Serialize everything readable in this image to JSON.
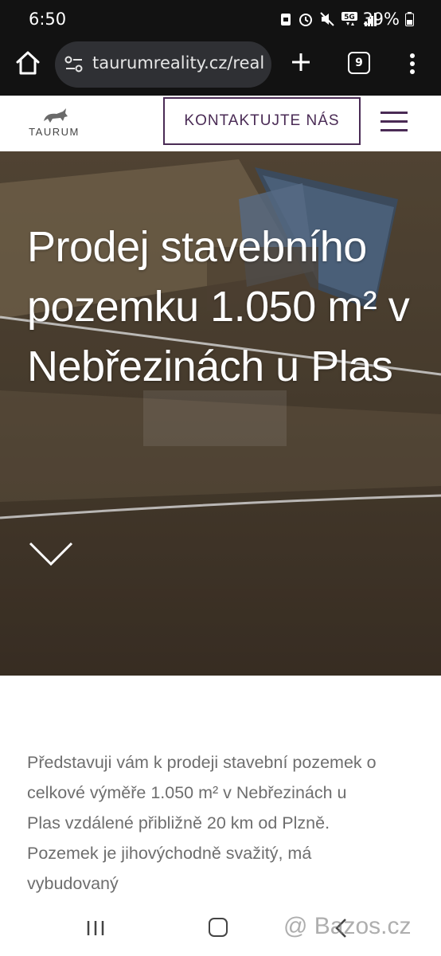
{
  "status_bar": {
    "time": "6:50",
    "battery": "39%",
    "network": "5G"
  },
  "browser": {
    "url": "taurumreality.cz/real",
    "tab_count": "9"
  },
  "site": {
    "logo_text": "TAURUM",
    "contact_button": "KONTAKTUJTE NÁS",
    "accent_color": "#4a2b55"
  },
  "hero": {
    "title": "Prodej stavebního pozemku 1.050 m² v Nebřezinách u Plas"
  },
  "content": {
    "description": "Představuji vám k prodeji stavební pozemek o celkové výměře 1.050 m² v Nebřezinách u Plas vzdálené přibližně 20 km od Plzně. Pozemek je jihovýchodně svažitý, má vybudovaný"
  },
  "watermark": "@ Bazos.cz"
}
